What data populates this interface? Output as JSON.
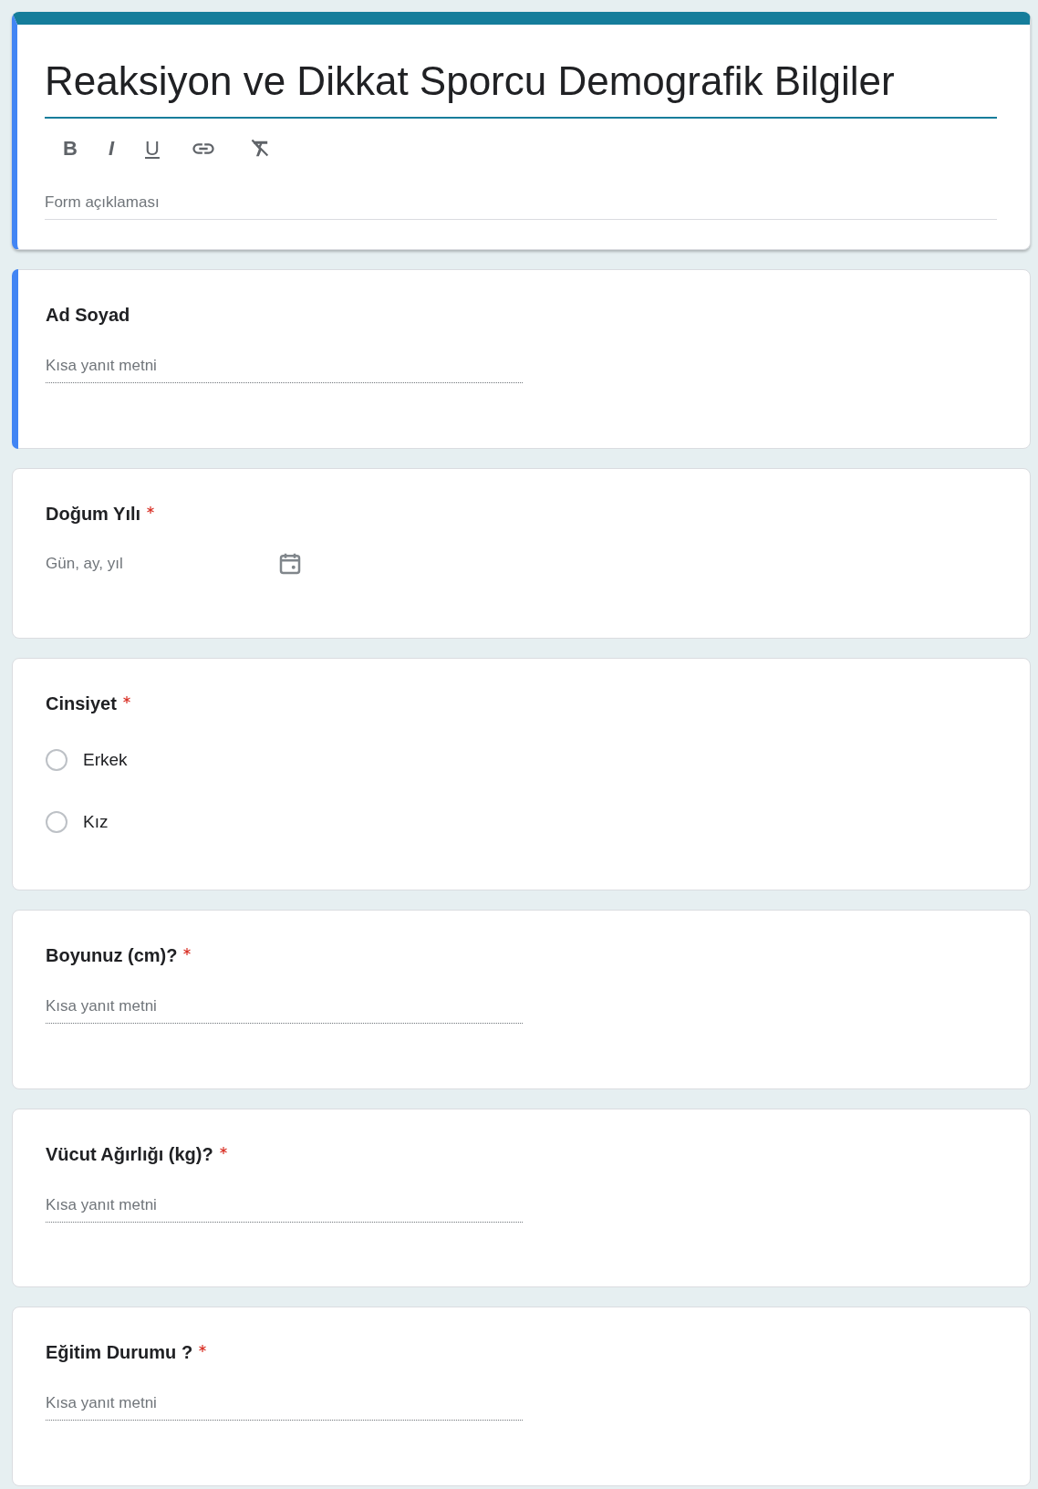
{
  "form": {
    "title": "Reaksiyon ve Dikkat Sporcu Demografik Bilgiler",
    "toolbar": [
      {
        "kind": "bold",
        "label": "B"
      },
      {
        "kind": "italic",
        "label": "I"
      },
      {
        "kind": "underline",
        "label": "U"
      },
      {
        "kind": "link"
      },
      {
        "kind": "clear"
      }
    ],
    "description_placeholder": "Form açıklaması"
  },
  "questions": [
    {
      "kind": "short",
      "title": "Ad Soyad",
      "required": false,
      "selected": true,
      "placeholder": "Kısa yanıt metni"
    },
    {
      "kind": "date",
      "title": "Doğum Yılı",
      "required": true,
      "selected": false,
      "placeholder": "Gün, ay, yıl"
    },
    {
      "kind": "radio",
      "title": "Cinsiyet",
      "required": true,
      "selected": false,
      "options": [
        {
          "label": "Erkek",
          "selected": false
        },
        {
          "label": "Kız",
          "selected": false
        }
      ]
    },
    {
      "kind": "short",
      "title": "Boyunuz (cm)?",
      "required": true,
      "selected": false,
      "placeholder": "Kısa yanıt metni"
    },
    {
      "kind": "short",
      "title": "Vücut Ağırlığı (kg)?",
      "required": true,
      "selected": false,
      "placeholder": "Kısa yanıt metni"
    },
    {
      "kind": "short",
      "title": "Eğitim Durumu ?",
      "required": true,
      "selected": false,
      "placeholder": "Kısa yanıt metni"
    }
  ]
}
